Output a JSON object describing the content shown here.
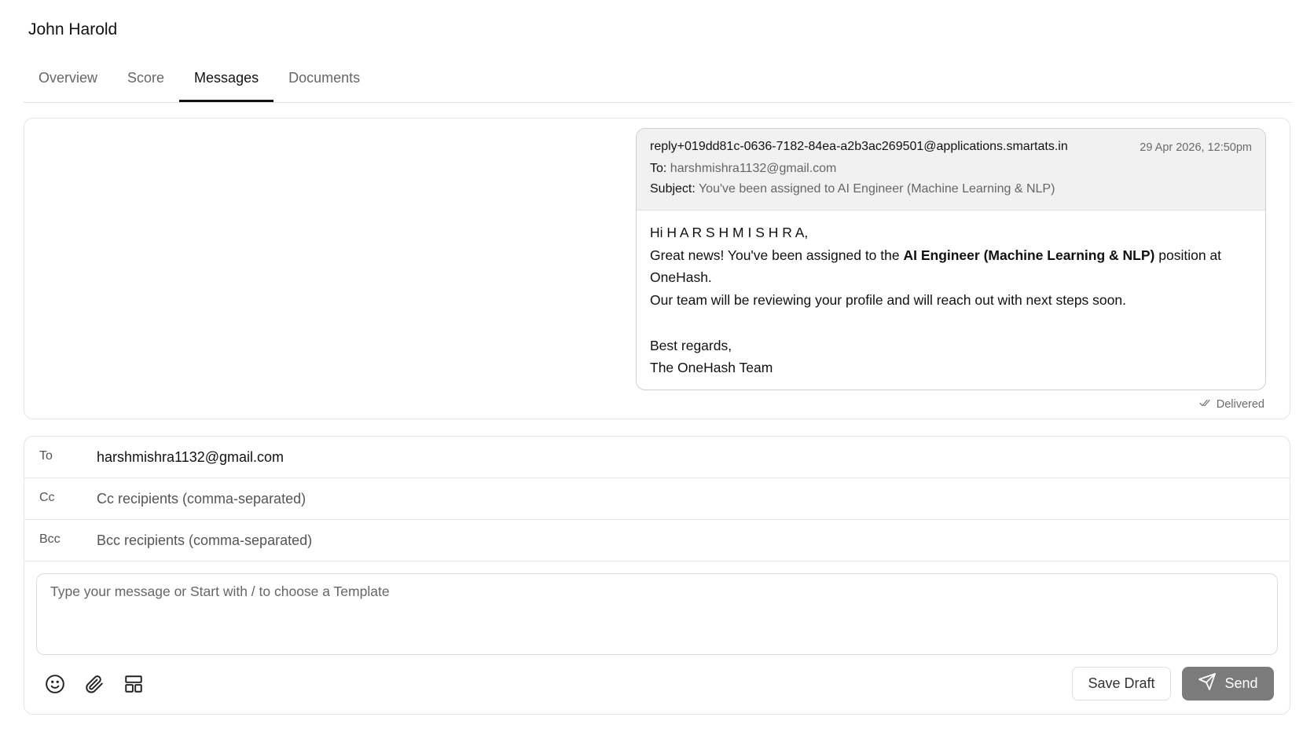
{
  "page": {
    "title": "John Harold"
  },
  "tabs": [
    {
      "label": "Overview"
    },
    {
      "label": "Score"
    },
    {
      "label": "Messages",
      "active": true
    },
    {
      "label": "Documents"
    }
  ],
  "thread": {
    "email": {
      "from": "reply+019dd81c-0636-7182-84ea-a2b3ac269501@applications.smartats.in",
      "date": "29 Apr 2026, 12:50pm",
      "to_label": "To:",
      "to": "harshmishra1132@gmail.com",
      "subject_label": "Subject:",
      "subject": "You've been assigned to AI Engineer (Machine Learning & NLP)",
      "body": {
        "greeting": "Hi H A R S H M I S H R A,",
        "line2_pre": "Great news! You've been assigned to the ",
        "line2_bold": "AI Engineer (Machine Learning & NLP)",
        "line2_post": " position at",
        "line3": "OneHash.",
        "line4": "Our team will be reviewing your profile and will reach out with next steps soon.",
        "signoff": "Best regards,",
        "signature": "The OneHash Team"
      }
    },
    "status": "Delivered"
  },
  "composer": {
    "to_label": "To",
    "to_value": "harshmishra1132@gmail.com",
    "cc_label": "Cc",
    "cc_placeholder": "Cc recipients (comma-separated)",
    "bcc_label": "Bcc",
    "bcc_placeholder": "Bcc recipients (comma-separated)",
    "message_placeholder": "Type your message or Start with / to choose a Template",
    "tools": [
      "emoji-icon",
      "attachment-icon",
      "template-icon"
    ],
    "save_draft_label": "Save Draft",
    "send_label": "Send"
  }
}
